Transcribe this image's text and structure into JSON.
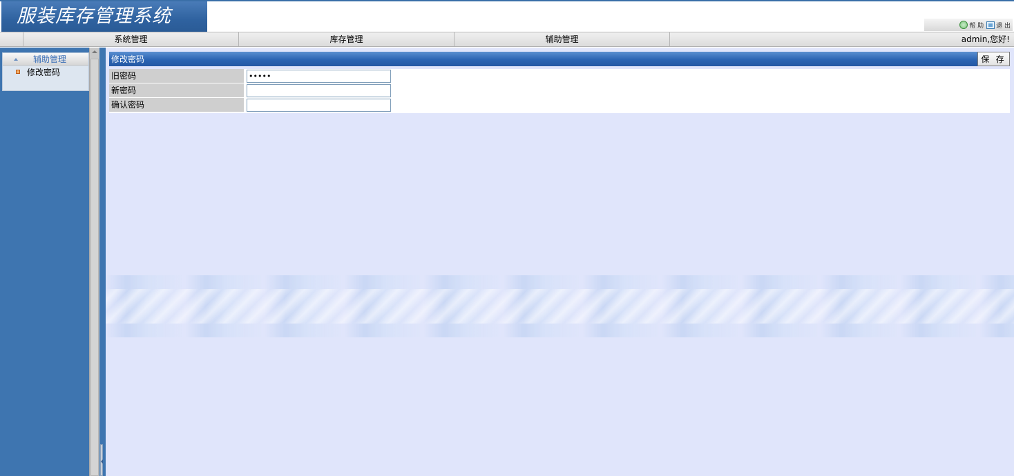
{
  "app": {
    "title": "服装库存管理系统"
  },
  "toplinks": {
    "help": "帮 助",
    "exit": "退 出"
  },
  "menu": {
    "items": [
      "系统管理",
      "库存管理",
      "辅助管理"
    ],
    "greeting": "admin,您好!"
  },
  "sidebar": {
    "group": "辅助管理",
    "items": [
      "修改密码"
    ]
  },
  "panel": {
    "title": "修改密码",
    "save_label": "保 存"
  },
  "form": {
    "old_password": {
      "label": "旧密码",
      "value": "•••••"
    },
    "new_password": {
      "label": "新密码",
      "value": ""
    },
    "confirm_password": {
      "label": "确认密码",
      "value": ""
    }
  }
}
